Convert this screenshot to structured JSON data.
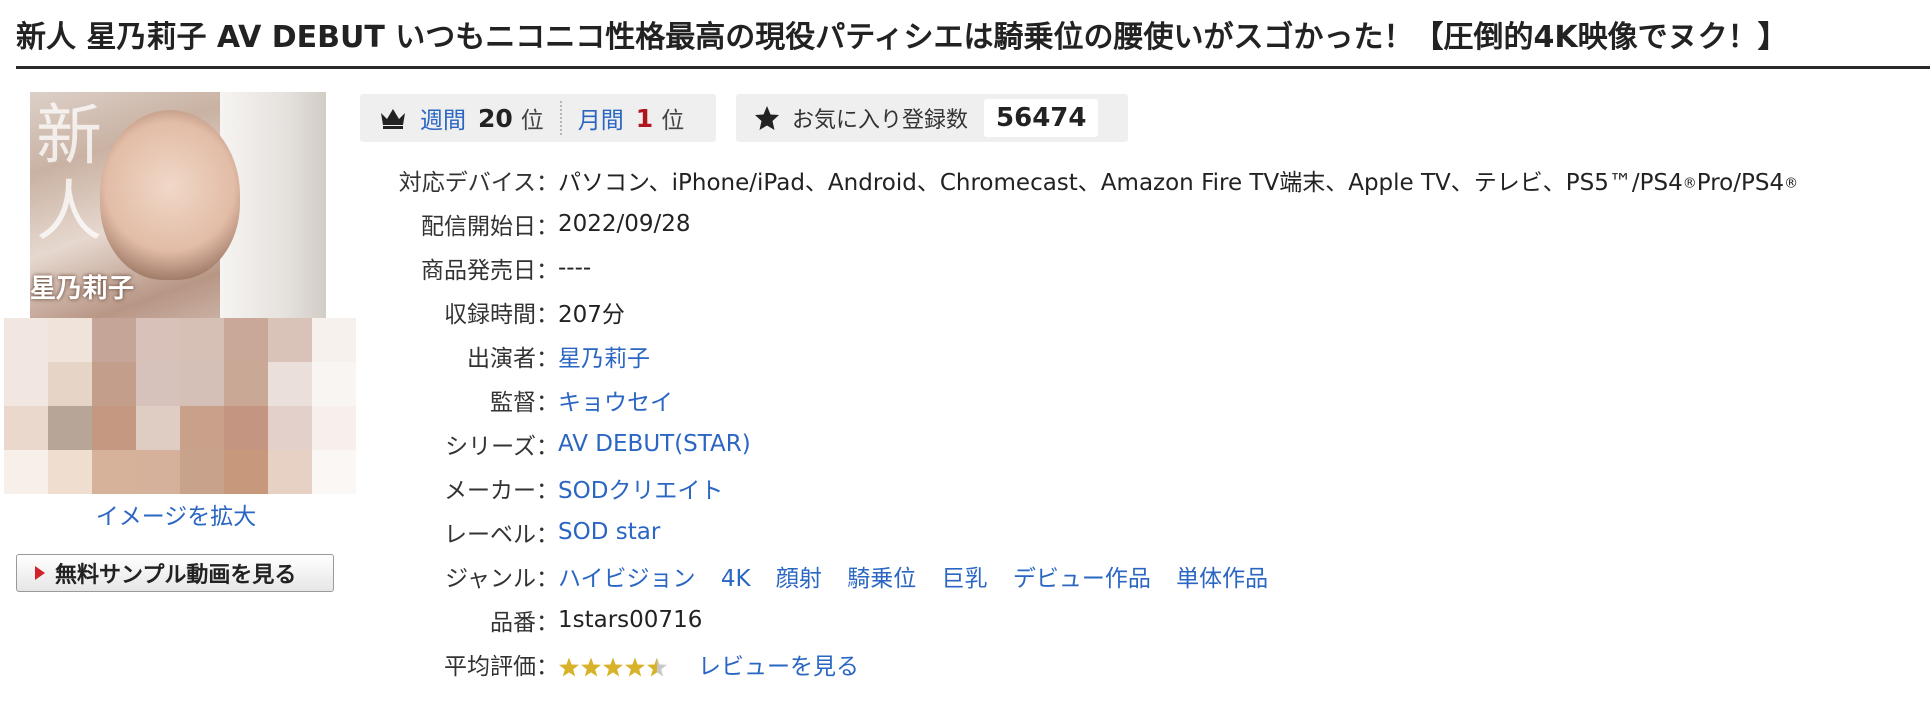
{
  "title": "新人 星乃莉子 AV DEBUT いつもニコニコ性格最高の現役パティシエは騎乗位の腰使いがスゴかった！【圧倒的4K映像でヌク！】",
  "cover": {
    "kanji": "新人",
    "name": "星乃莉子"
  },
  "enlarge_label": "イメージを拡大",
  "sample_button_label": "無料サンプル動画を見る",
  "ranking": {
    "weekly_label": "週間",
    "weekly_rank": "20",
    "monthly_label": "月間",
    "monthly_rank": "1",
    "unit": "位"
  },
  "favorite": {
    "label": "お気に入り登録数",
    "count": "56474"
  },
  "info": {
    "devices": {
      "label": "対応デバイス",
      "value": "パソコン、iPhone/iPad、Android、Chromecast、Amazon Fire TV端末、Apple TV、テレビ、PS5™/PS4",
      "pro": "Pro/PS4",
      "reg": "®"
    },
    "release_date": {
      "label": "配信開始日",
      "value": "2022/09/28"
    },
    "sale_date": {
      "label": "商品発売日",
      "value": "----"
    },
    "duration": {
      "label": "収録時間",
      "value": "207分"
    },
    "actress": {
      "label": "出演者",
      "value": "星乃莉子"
    },
    "director": {
      "label": "監督",
      "value": "キョウセイ"
    },
    "series": {
      "label": "シリーズ",
      "value": "AV DEBUT(STAR)"
    },
    "maker": {
      "label": "メーカー",
      "value": "SODクリエイト"
    },
    "label_row": {
      "label": "レーベル",
      "value": "SOD star"
    },
    "genre": {
      "label": "ジャンル",
      "tags": [
        "ハイビジョン",
        "4K",
        "顔射",
        "騎乗位",
        "巨乳",
        "デビュー作品",
        "単体作品"
      ]
    },
    "product_id": {
      "label": "品番",
      "value": "1stars00716"
    },
    "rating": {
      "label": "平均評価",
      "stars": 4.5,
      "review_link": "レビューを見る"
    }
  },
  "colon": "：",
  "colors": {
    "link": "#2a66c2",
    "rank_highlight": "#b0141c",
    "box_bg": "#efefef",
    "star_gold": "#d7b22a"
  },
  "icons": [
    "crown-icon",
    "star-icon",
    "play-icon",
    "rating-stars-icon"
  ]
}
